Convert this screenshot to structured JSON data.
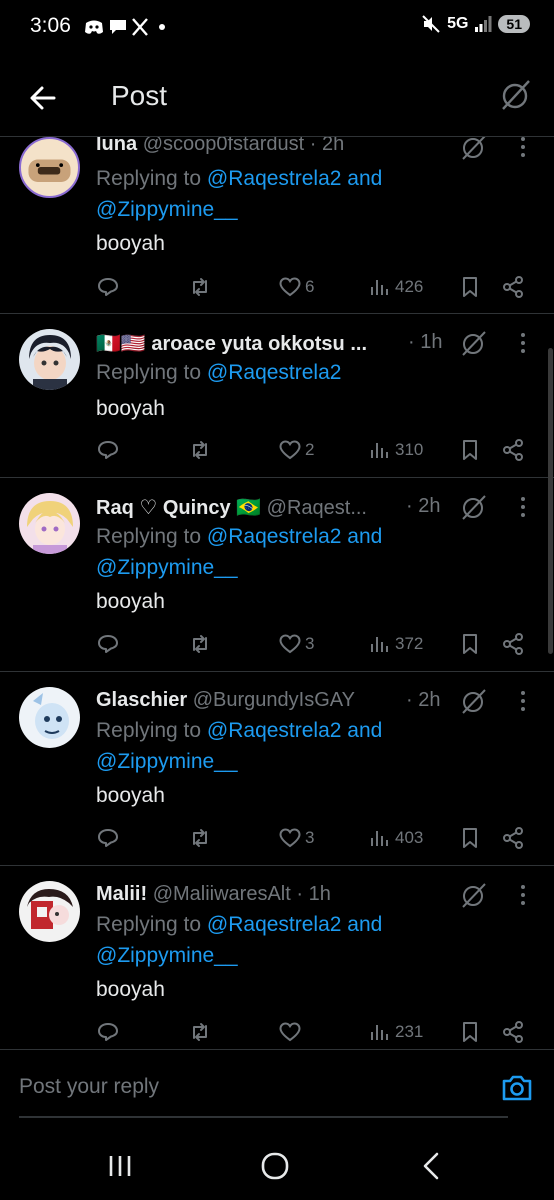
{
  "status_bar": {
    "time": "3:06",
    "network": "5G",
    "battery": "51"
  },
  "header": {
    "title": "Post"
  },
  "replies": [
    {
      "display_name": "luna",
      "handle": "@scoop0fstardust",
      "time": "· 2h",
      "replying_prefix": "Replying to ",
      "mentions_line1": "@Raqestrela2",
      "connector": " and",
      "mentions_line2": "@Zippymine__",
      "text": "booyah",
      "likes": "6",
      "views": "426"
    },
    {
      "display_name": "🇲🇽🇺🇸 aroace yuta okkotsu ...",
      "handle": "",
      "time": "· 1h",
      "replying_prefix": "Replying to ",
      "mentions_line1": "@Raqestrela2",
      "connector": "",
      "mentions_line2": "",
      "text": "booyah",
      "likes": "2",
      "views": "310"
    },
    {
      "display_name": "Raq ♡ Quincy 🇧🇷",
      "handle": "@Raqest...",
      "time": "· 2h",
      "replying_prefix": "Replying to ",
      "mentions_line1": "@Raqestrela2",
      "connector": " and",
      "mentions_line2": "@Zippymine__",
      "text": "booyah",
      "likes": "3",
      "views": "372"
    },
    {
      "display_name": "Glaschier",
      "handle": "@BurgundyIsGAY",
      "time": "· 2h",
      "replying_prefix": "Replying to ",
      "mentions_line1": "@Raqestrela2",
      "connector": " and",
      "mentions_line2": "@Zippymine__",
      "text": "booyah",
      "likes": "3",
      "views": "403"
    },
    {
      "display_name": "Malii!",
      "handle": "@MaliiwaresAlt",
      "time": "· 1h",
      "replying_prefix": "Replying to ",
      "mentions_line1": "@Raqestrela2",
      "connector": " and",
      "mentions_line2": "@Zippymine__",
      "text": "booyah",
      "likes": "",
      "views": "231"
    }
  ],
  "composer": {
    "placeholder": "Post your reply"
  },
  "icons": {
    "back": "arrow-left-icon",
    "grok": "grok-slash-circle-icon",
    "more": "more-vertical-icon",
    "reply": "reply-bubble-icon",
    "repost": "repost-icon",
    "like": "heart-icon",
    "views": "analytics-bars-icon",
    "bookmark": "bookmark-icon",
    "share": "share-icon",
    "camera": "camera-icon"
  },
  "colors": {
    "background": "#000000",
    "text": "#e7e9ea",
    "muted": "#71767b",
    "accent": "#1d9bf0",
    "divider": "#2f3336"
  }
}
